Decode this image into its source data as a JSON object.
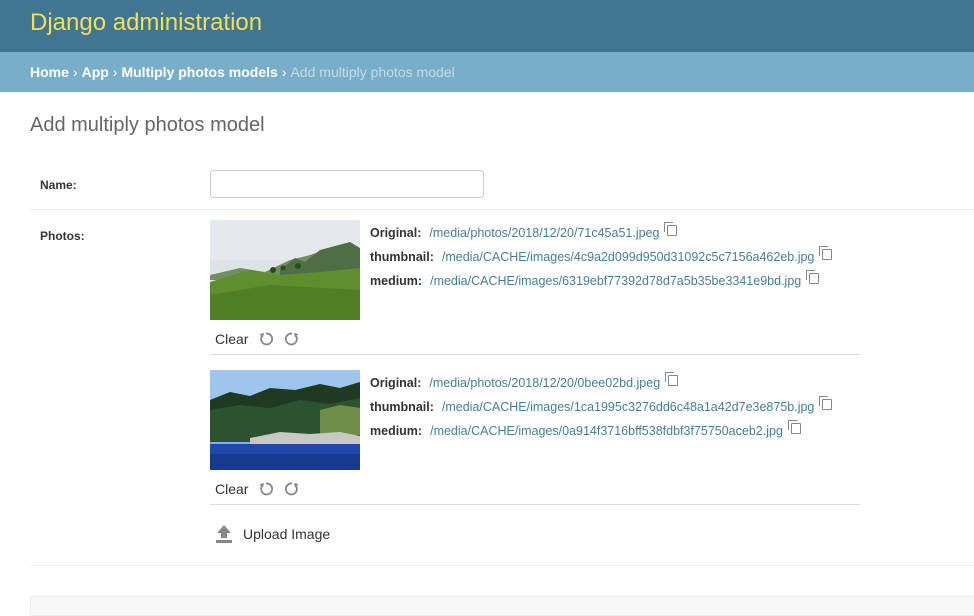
{
  "header": {
    "branding": "Django administration"
  },
  "breadcrumbs": {
    "home": "Home",
    "app": "App",
    "model": "Multiply photos models",
    "current": "Add multiply photos model",
    "separator": "›"
  },
  "page_title": "Add multiply photos model",
  "form": {
    "name_label": "Name:",
    "name_value": "",
    "photos_label": "Photos:",
    "photos": [
      {
        "original_label": "Original:",
        "original_url": "/media/photos/2018/12/20/71c45a51.jpeg",
        "thumbnail_label": "thumbnail:",
        "thumbnail_url": "/media/CACHE/images/4c9a2d099d950d31092c5c7156a462eb.jpg",
        "medium_label": "medium:",
        "medium_url": "/media/CACHE/images/6319ebf77392d78d7a5b35be3341e9bd.jpg",
        "clear_label": "Clear"
      },
      {
        "original_label": "Original:",
        "original_url": "/media/photos/2018/12/20/0bee02bd.jpeg",
        "thumbnail_label": "thumbnail:",
        "thumbnail_url": "/media/CACHE/images/1ca1995c3276dd6c48a1a42d7e3e875b.jpg",
        "medium_label": "medium:",
        "medium_url": "/media/CACHE/images/0a914f3716bff538fdbf3f75750aceb2.jpg",
        "clear_label": "Clear"
      }
    ],
    "upload_label": "Upload Image"
  },
  "colors": {
    "header_bg": "#417690",
    "branding": "#f5dd5d",
    "breadcrumbs_bg": "#79aec8",
    "link": "#447e9b"
  }
}
